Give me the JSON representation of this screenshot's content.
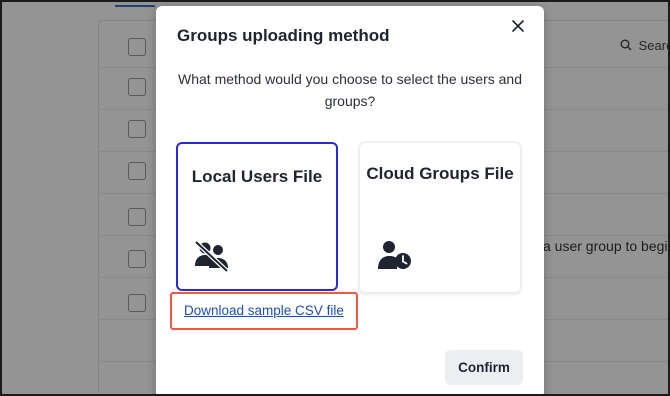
{
  "background": {
    "search_label": "Search",
    "hint_text": "a user group to begi"
  },
  "modal": {
    "title": "Groups uploading method",
    "question": "What method would you choose to select the users and groups?",
    "options": [
      {
        "label": "Local Users File",
        "icon": "users-slash-icon",
        "selected": true
      },
      {
        "label": "Cloud Groups File",
        "icon": "user-clock-icon",
        "selected": false
      }
    ],
    "download_link": "Download sample CSV file",
    "confirm_label": "Confirm"
  },
  "colors": {
    "selected_border": "#2a2ad6",
    "highlight_border": "#ef5a45",
    "link": "#1a4fc4"
  }
}
